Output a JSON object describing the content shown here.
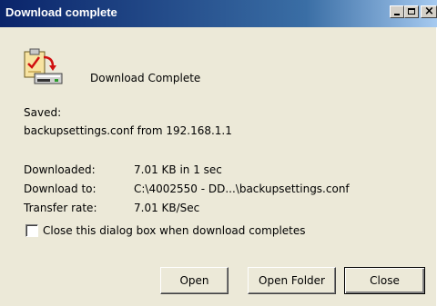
{
  "window": {
    "title": "Download complete",
    "controls": {
      "minimize": "minimize-icon",
      "maximize": "maximize-icon",
      "close": "close-icon"
    }
  },
  "header": {
    "icon": "download-clipboard-icon",
    "heading": "Download Complete"
  },
  "saved": {
    "label": "Saved:",
    "value": "backupsettings.conf from 192.168.1.1"
  },
  "details": [
    {
      "label": "Downloaded:",
      "value": "7.01 KB in 1 sec"
    },
    {
      "label": "Download to:",
      "value": "C:\\4002550 - DD...\\backupsettings.conf"
    },
    {
      "label": "Transfer rate:",
      "value": "7.01 KB/Sec"
    }
  ],
  "close_when_complete": {
    "label": "Close this dialog box when download completes",
    "checked": false
  },
  "buttons": {
    "open": "Open",
    "open_folder": "Open Folder",
    "close": "Close"
  }
}
